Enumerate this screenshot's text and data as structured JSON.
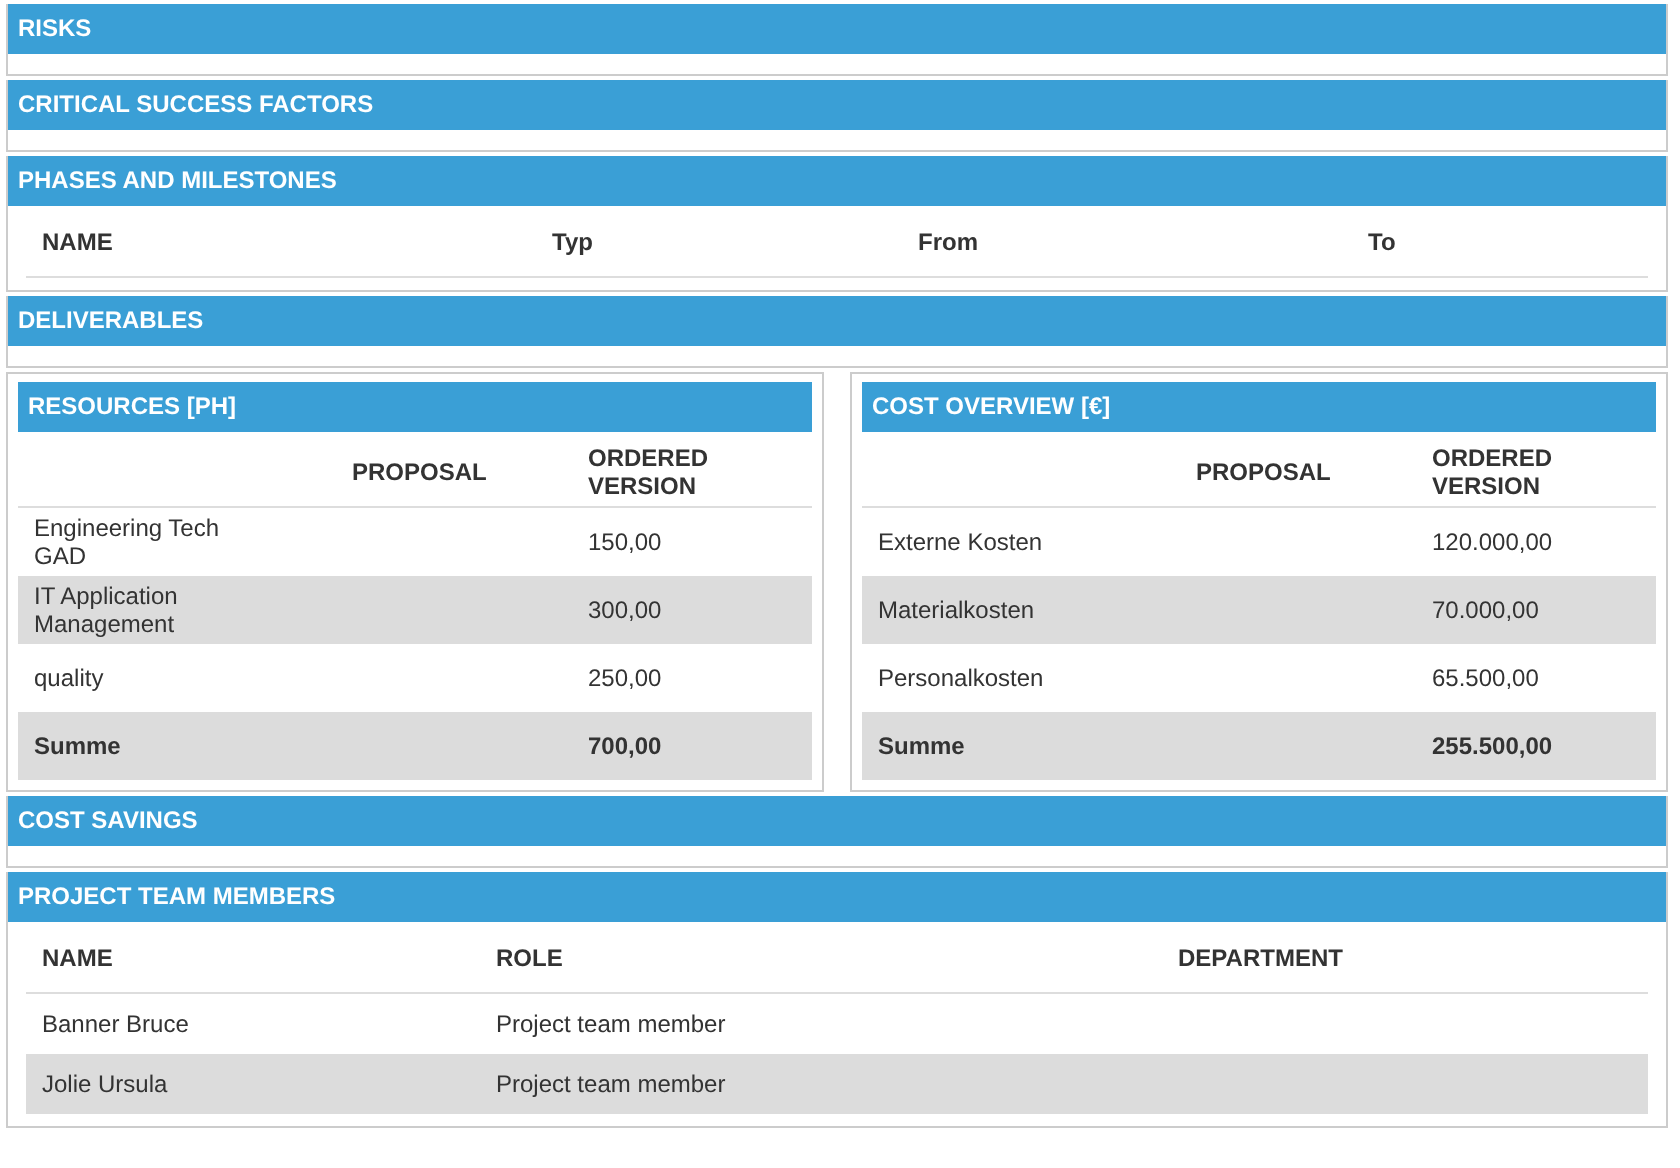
{
  "sections": [
    {
      "kind": "empty",
      "title": "RISKS"
    },
    {
      "kind": "empty",
      "title": "CRITICAL SUCCESS FACTORS"
    },
    {
      "kind": "table",
      "title": "PHASES AND MILESTONES",
      "columns": [
        "NAME",
        "Typ",
        "From",
        "To"
      ]
    },
    {
      "kind": "empty",
      "title": "DELIVERABLES"
    },
    {
      "kind": "split",
      "panels": [
        {
          "title": "RESOURCES [PH]",
          "columns": [
            "",
            "PROPOSAL",
            "ORDERED VERSION"
          ],
          "rows": [
            {
              "kind": "item",
              "cells": [
                "Engineering Tech GAD",
                "",
                "150,00"
              ]
            },
            {
              "kind": "item",
              "cells": [
                "IT Application Management",
                "",
                "300,00"
              ]
            },
            {
              "kind": "item",
              "cells": [
                "quality",
                "",
                "250,00"
              ]
            },
            {
              "kind": "total",
              "cells": [
                "Summe",
                "",
                "700,00"
              ]
            }
          ]
        },
        {
          "title": "COST OVERVIEW [€]",
          "columns": [
            "",
            "PROPOSAL",
            "ORDERED VERSION"
          ],
          "rows": [
            {
              "kind": "item",
              "cells": [
                "Externe Kosten",
                "",
                "120.000,00"
              ]
            },
            {
              "kind": "item",
              "cells": [
                "Materialkosten",
                "",
                "70.000,00"
              ]
            },
            {
              "kind": "item",
              "cells": [
                "Personalkosten",
                "",
                "65.500,00"
              ]
            },
            {
              "kind": "total",
              "cells": [
                "Summe",
                "",
                "255.500,00"
              ]
            }
          ]
        }
      ]
    },
    {
      "kind": "empty",
      "title": "COST SAVINGS"
    },
    {
      "kind": "table",
      "title": "PROJECT TEAM MEMBERS",
      "columns": [
        "NAME",
        "ROLE",
        "DEPARTMENT"
      ],
      "rows": [
        {
          "cells": [
            "Banner Bruce",
            "Project team member",
            ""
          ]
        },
        {
          "cells": [
            "Jolie Ursula",
            "Project team member",
            ""
          ]
        }
      ]
    }
  ]
}
